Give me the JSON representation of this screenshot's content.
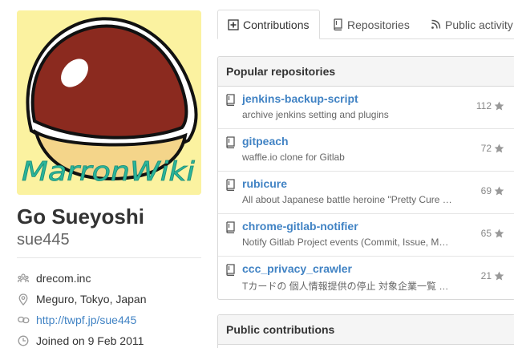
{
  "profile": {
    "avatar_text": "MarronWiki",
    "fullname": "Go Sueyoshi",
    "username": "sue445",
    "details": [
      {
        "icon": "organization-icon",
        "text": "drecom.inc"
      },
      {
        "icon": "location-icon",
        "text": "Meguro, Tokyo, Japan"
      },
      {
        "icon": "link-icon",
        "text": "http://twpf.jp/sue445"
      },
      {
        "icon": "clock-icon",
        "text": "Joined on 9 Feb 2011"
      }
    ]
  },
  "tabs": [
    {
      "label": "Contributions",
      "icon": "plus-square-icon",
      "selected": true
    },
    {
      "label": "Repositories",
      "icon": "repo-icon",
      "selected": false
    },
    {
      "label": "Public activity",
      "icon": "rss-icon",
      "selected": false
    }
  ],
  "popular": {
    "title": "Popular repositories",
    "repos": [
      {
        "name": "jenkins-backup-script",
        "description": "archive jenkins setting and plugins",
        "stars": "112"
      },
      {
        "name": "gitpeach",
        "description": "waffle.io clone for Gitlab",
        "stars": "72"
      },
      {
        "name": "rubicure",
        "description": "All about Japanese battle heroine \"Pretty Cure (Precure)\"",
        "stars": "69"
      },
      {
        "name": "chrome-gitlab-notifier",
        "description": "Notify Gitlab Project events (Commit, Issue, Merge Request...)",
        "stars": "65"
      },
      {
        "name": "ccc_privacy_crawler",
        "description": "Tカードの 個人情報提供の停止 対象企業一覧 をクロールする",
        "stars": "21"
      }
    ]
  },
  "contributions": {
    "title": "Public contributions"
  },
  "colors": {
    "link": "#4183c4",
    "avatar_background": "#fbf2a0",
    "chestnut": "#8b2a1f",
    "chestnut_base": "#f4d58a",
    "avatar_text": "#2bb59a"
  }
}
